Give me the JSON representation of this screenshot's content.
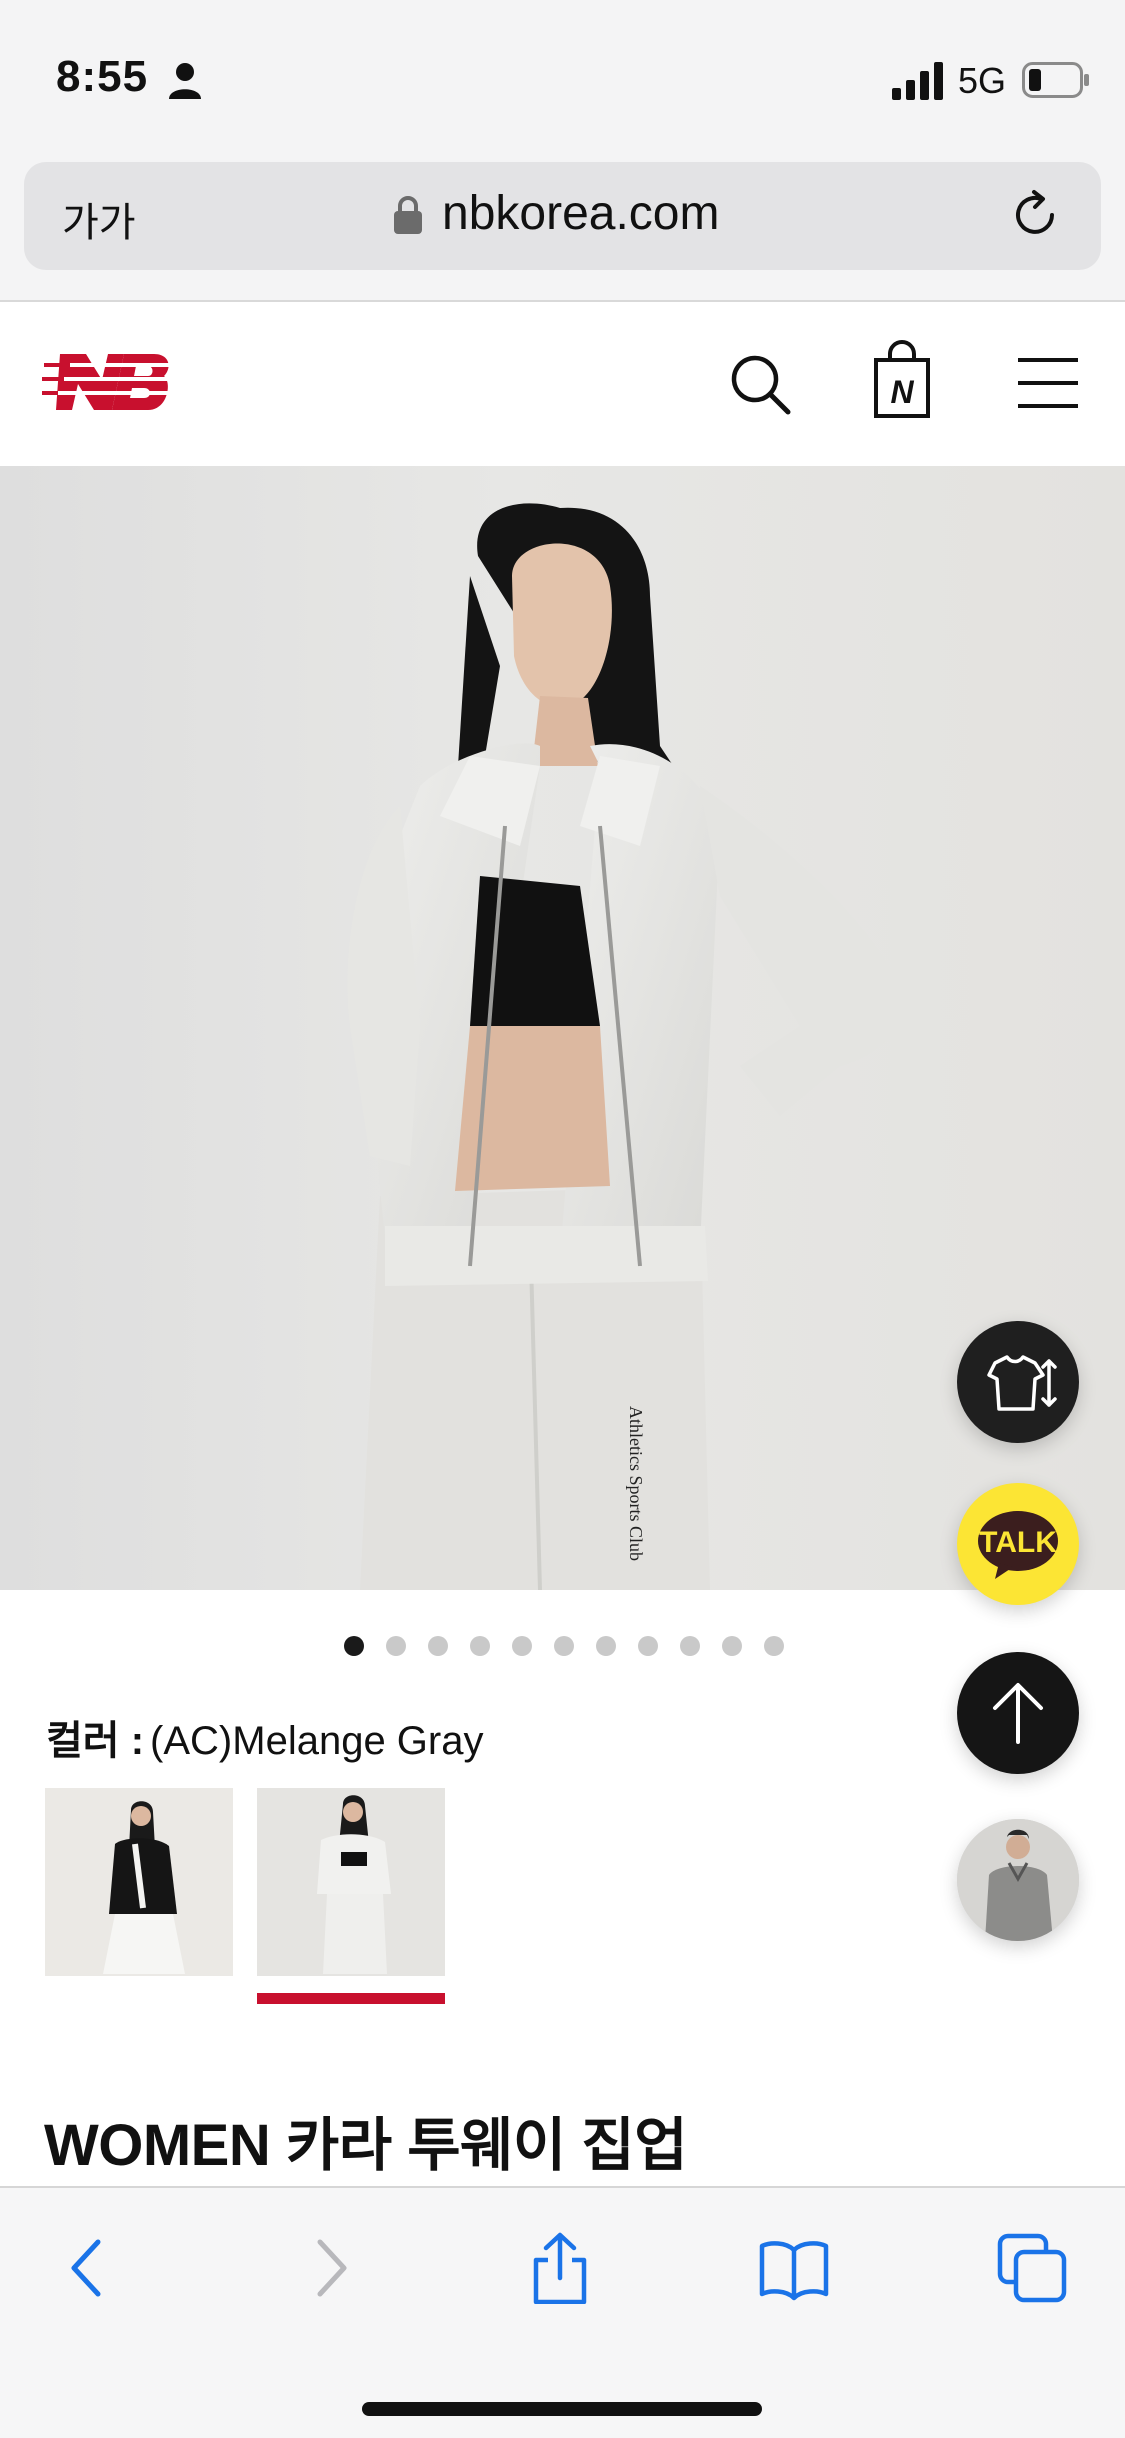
{
  "status_bar": {
    "time": "8:55",
    "network": "5G",
    "icons": [
      "person-icon",
      "signal-icon",
      "battery-icon"
    ]
  },
  "browser": {
    "text_size_button": "가가",
    "domain": "nbkorea.com",
    "icons": [
      "lock-icon",
      "reload-icon"
    ]
  },
  "site_header": {
    "icons": [
      "nb-logo",
      "search-icon",
      "shopping-bag-icon",
      "menu-icon"
    ],
    "brand_color": "#c8102e",
    "bag_letter": "N"
  },
  "hero": {
    "image": "woman wearing gray collared zip-up jacket and gray sweatpants",
    "pants_print": "Athletics Sports Club",
    "slide_count": 11,
    "active_slide": 1
  },
  "floating_buttons": {
    "fit_icon": "shirt-size-icon",
    "talk_label": "TALK",
    "top_icon": "arrow-up-icon",
    "recent_view": "recently-viewed-product-thumbnail"
  },
  "product": {
    "color_label": "컬러 :",
    "color_value": "(AC)Melange Gray",
    "swatches": [
      "black jacket look",
      "gray jacket look"
    ],
    "selected_swatch": 2,
    "title": "WOMEN 카라 투웨이 집업"
  },
  "toolbar": {
    "icons": [
      "back-icon",
      "forward-icon",
      "share-icon",
      "bookmarks-icon",
      "tabs-icon"
    ],
    "accent_color": "#1a73e8"
  }
}
